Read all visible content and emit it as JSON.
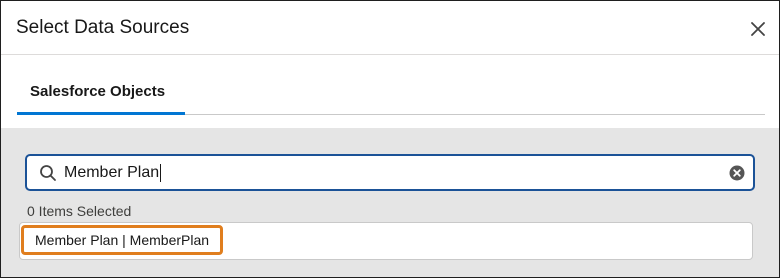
{
  "modal": {
    "title": "Select Data Sources",
    "close_icon": "close-icon"
  },
  "tabs": [
    {
      "label": "Salesforce Objects",
      "active": true
    }
  ],
  "search": {
    "value": "Member Plan",
    "search_icon": "search-icon",
    "clear_icon": "clear-icon"
  },
  "selection": {
    "count_text": "0 Items Selected"
  },
  "results": [
    {
      "label": "Member Plan | MemberPlan",
      "highlighted": true
    }
  ],
  "colors": {
    "accent": "#0176d3",
    "search_border": "#1b5297",
    "highlight": "#e07e1e",
    "panel_bg": "#e5e5e5"
  }
}
